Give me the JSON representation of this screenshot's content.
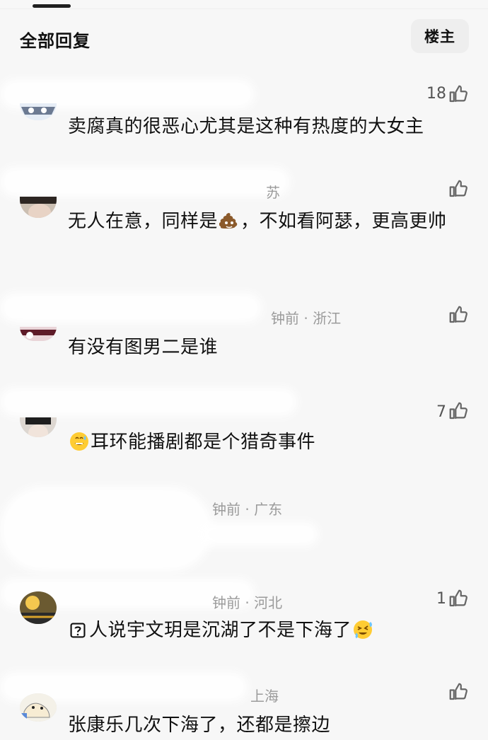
{
  "header": {
    "title": "全部回复",
    "filter_button": "楼主"
  },
  "comments": [
    {
      "meta": "",
      "likes": "18",
      "text": "卖腐真的很恶心尤其是这种有热度的大女主"
    },
    {
      "meta": "苏",
      "likes": "",
      "text_before": "无人在意，同样是",
      "emoji_mid": "poop-emoji",
      "text_after": "，不如看阿瑟，更高更帅"
    },
    {
      "meta": "钟前 · 浙江",
      "likes": "",
      "text": "有没有图男二是谁"
    },
    {
      "meta": "",
      "likes": "7",
      "emoji_start": "sweat-smile-emoji",
      "text": "耳环能播剧都是个猎奇事件"
    },
    {
      "meta": "钟前 · 广东",
      "likes": "",
      "text": ""
    },
    {
      "meta": "钟前 · 河北",
      "likes": "1",
      "emoji_start": "question-box-icon",
      "text": "人说宇文玥是沉湖了不是下海了",
      "emoji_end": "rolling-laugh-emoji"
    },
    {
      "meta": "上海",
      "likes": "",
      "text": "张康乐几次下海了，还都是擦边"
    }
  ]
}
